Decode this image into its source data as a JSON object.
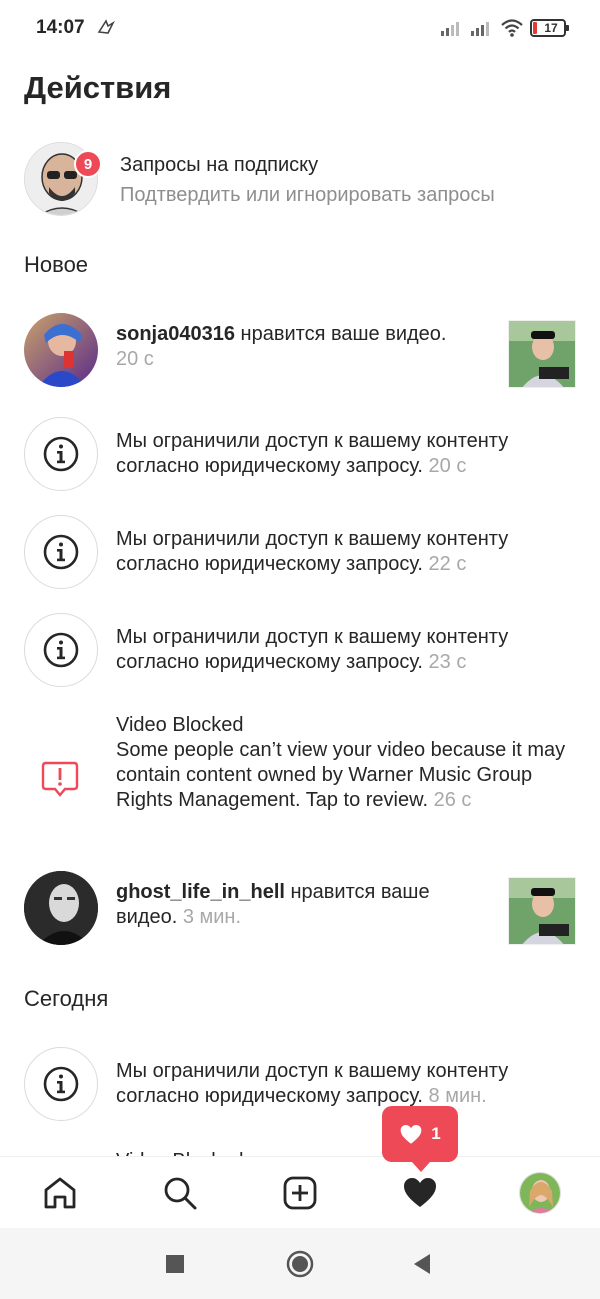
{
  "status_bar": {
    "time": "14:07",
    "battery": "17"
  },
  "title": "Действия",
  "follow_requests": {
    "badge": "9",
    "title": "Запросы на подписку",
    "subtitle": "Подтвердить или игнорировать запросы"
  },
  "sections": {
    "new": "Новое",
    "today": "Сегодня"
  },
  "notifications": {
    "n1": {
      "username": "sonja040316",
      "text": " нравится ваше видео.",
      "time": "20 с"
    },
    "n2": {
      "text": "Мы ограничили доступ к вашему контенту согласно юридическому запросу. ",
      "time": "20 с"
    },
    "n3": {
      "text": "Мы ограничили доступ к вашему контенту согласно юридическому запросу. ",
      "time": "22 с"
    },
    "n4": {
      "text": "Мы ограничили доступ к вашему контенту согласно юридическому запросу. ",
      "time": "23 с"
    },
    "n5": {
      "title": "Video Blocked",
      "text": "Some people can’t view your video because it may contain content owned by Warner Music Group Rights Management. Tap to review. ",
      "time": "26 с"
    },
    "n6": {
      "username": "ghost_life_in_hell",
      "text": " нравится ваше видео. ",
      "time": "3 мин."
    },
    "n7": {
      "text": "Мы ограничили доступ к вашему контенту согласно юридическому запросу. ",
      "time": "8 мин."
    },
    "n8_peek": "Video Blocked"
  },
  "like_toast": {
    "count": "1"
  },
  "bottom_nav": {
    "icons": [
      "home-icon",
      "search-icon",
      "add-post-icon",
      "heart-icon",
      "profile-avatar"
    ]
  },
  "colors": {
    "accent_red": "#ed4956",
    "muted_gray": "#8e8e8e"
  }
}
